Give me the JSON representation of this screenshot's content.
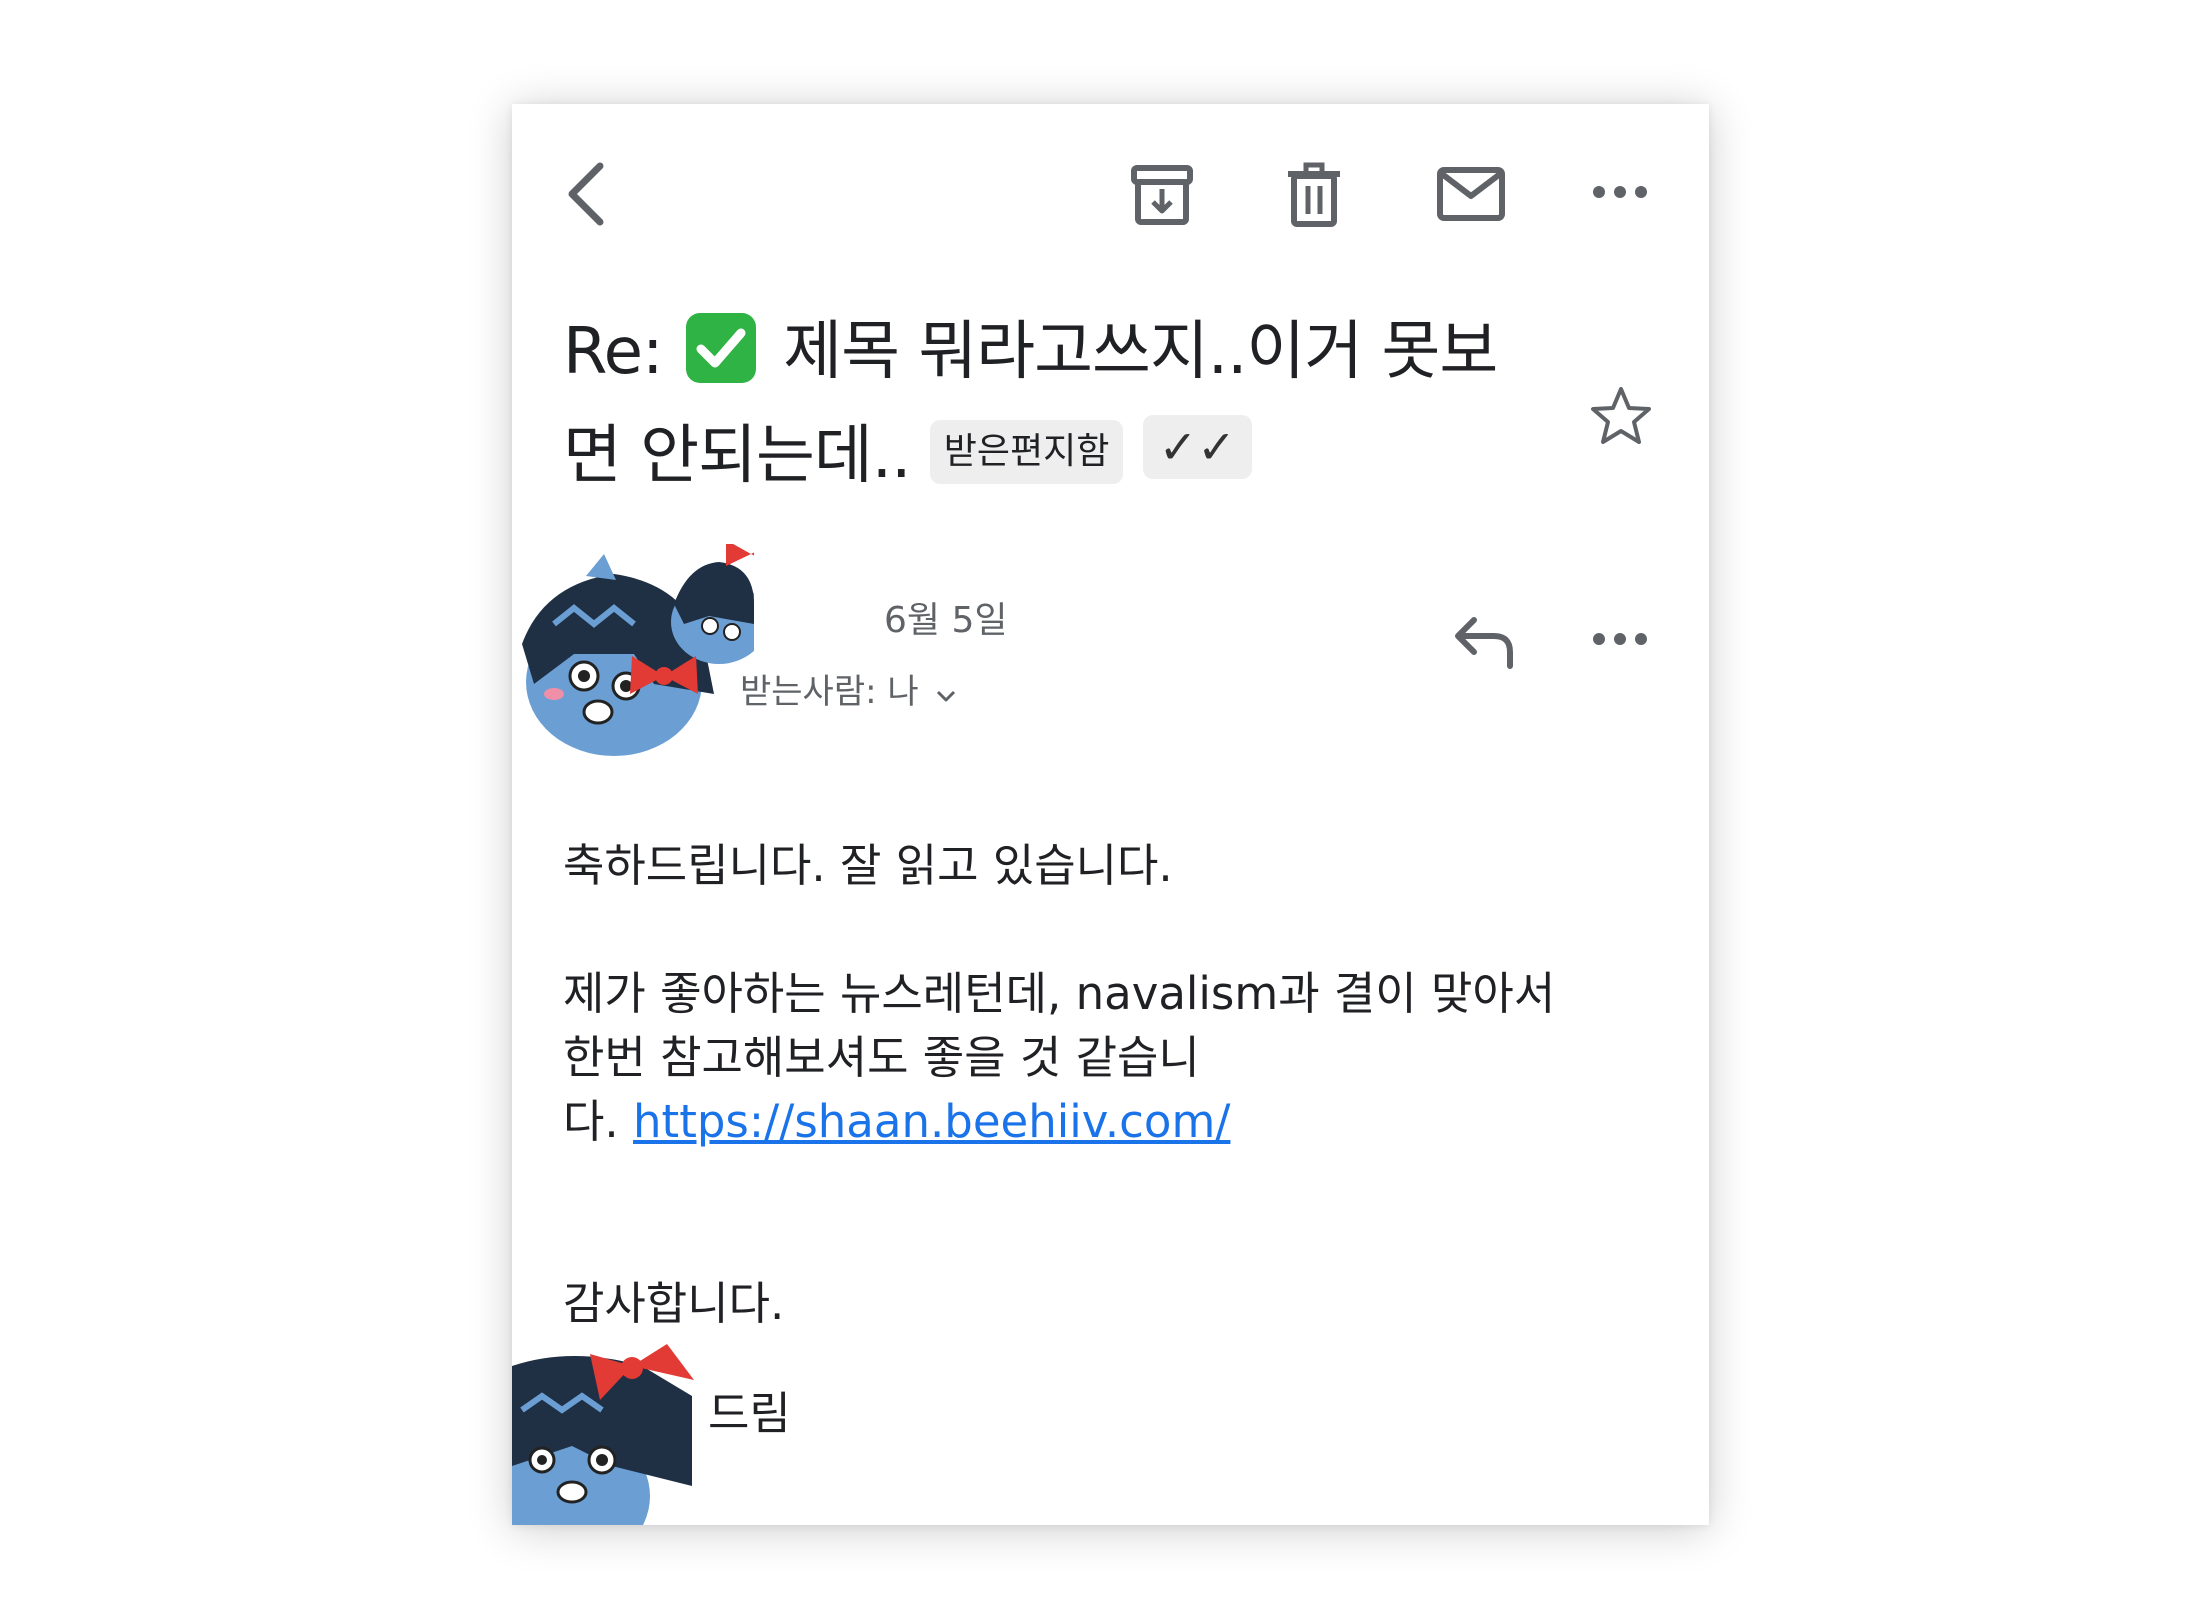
{
  "toolbar": {
    "back_icon": "chevron-left-icon",
    "archive_icon": "archive-icon",
    "delete_icon": "trash-icon",
    "mark_unread_icon": "mail-icon",
    "more_icon": "more-horizontal-icon"
  },
  "email": {
    "subject_prefix": "Re:",
    "subject_emoji": "white-check-mark-emoji",
    "subject_line1": "제목 뭐라고쓰지..이거 못보",
    "subject_line2": "면 안되는데..",
    "label_inbox": "받은편지함",
    "label_checks": "✓✓",
    "star_icon": "star-outline-icon",
    "date": "6월 5일",
    "to_label": "받는사람: 나",
    "to_expand_icon": "chevron-down-icon",
    "reply_icon": "reply-icon",
    "more_icon": "more-horizontal-icon",
    "body": {
      "line1": "축하드립니다. 잘 읽고 있습니다.",
      "line2": "제가 좋아하는 뉴스레턴데, navalism과 결이 맞아서",
      "line3": "한번 참고해보셔도 좋을 것 같습니",
      "line4_prefix": "다.",
      "link": "https://shaan.beehiiv.com/",
      "thanks": "감사합니다.",
      "signature": "드림"
    }
  },
  "colors": {
    "text": "#202124",
    "secondary": "#5f6368",
    "icon": "#5f6368",
    "link": "#1a73e8",
    "chip_bg": "#eeeeee",
    "check_emoji": "#2fb344"
  }
}
